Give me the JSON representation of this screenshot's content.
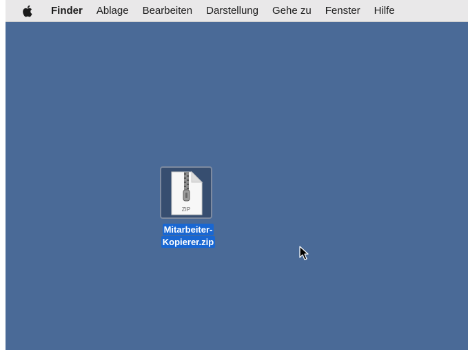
{
  "menubar": {
    "apple_icon": "apple-logo-icon",
    "app_name": "Finder",
    "items": [
      {
        "label": "Ablage"
      },
      {
        "label": "Bearbeiten"
      },
      {
        "label": "Darstellung"
      },
      {
        "label": "Gehe zu"
      },
      {
        "label": "Fenster"
      },
      {
        "label": "Hilfe"
      }
    ]
  },
  "desktop": {
    "background_color": "#4a6a97",
    "file": {
      "icon": "zip-archive-icon",
      "badge_text": "ZIP",
      "name_line1": "Mitarbeiter-",
      "name_line2": "Kopierer.zip",
      "selected": true,
      "selection_color": "#1967d2"
    },
    "cursor_icon": "arrow-pointer-icon"
  }
}
